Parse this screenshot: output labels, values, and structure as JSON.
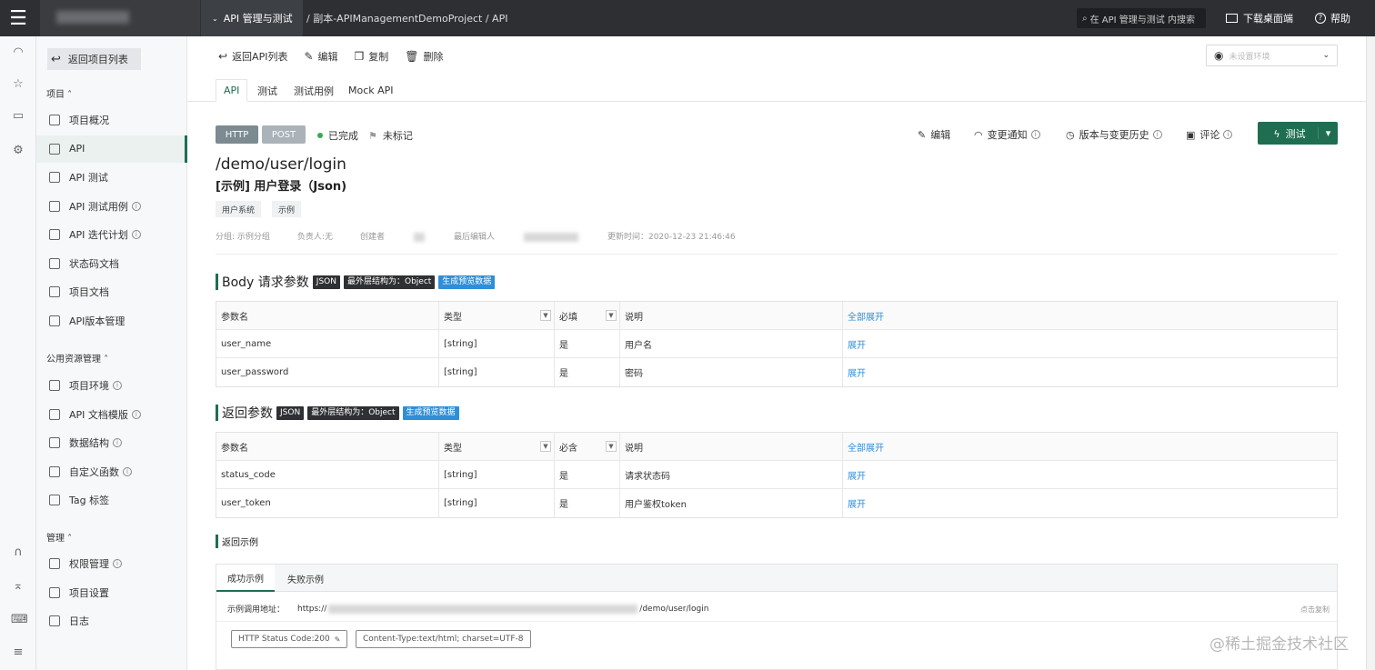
{
  "topbar": {
    "module": "API 管理与测试",
    "breadcrumb": "/ 副本-APIManagementDemoProject / API",
    "search_placeholder": "在 API 管理与测试 内搜索",
    "download": "下载桌面端",
    "help": "帮助"
  },
  "sidebar": {
    "back": "返回项目列表",
    "group_project": "项目 ˄",
    "items_project": [
      {
        "label": "项目概况",
        "icon": "overview-icon"
      },
      {
        "label": "API",
        "icon": "api-icon"
      },
      {
        "label": "API 测试",
        "icon": "test-icon"
      },
      {
        "label": "API 测试用例",
        "icon": "testcase-icon"
      },
      {
        "label": "API 迭代计划",
        "icon": "plan-icon"
      },
      {
        "label": "状态码文档",
        "icon": "code-doc-icon"
      },
      {
        "label": "项目文档",
        "icon": "doc-icon"
      },
      {
        "label": "API版本管理",
        "icon": "version-icon"
      }
    ],
    "group_public": "公用资源管理 ˄",
    "items_public": [
      {
        "label": "项目环境",
        "icon": "env-icon"
      },
      {
        "label": "API 文档模版",
        "icon": "template-icon"
      },
      {
        "label": "数据结构",
        "icon": "struct-icon"
      },
      {
        "label": "自定义函数",
        "icon": "function-icon"
      },
      {
        "label": "Tag 标签",
        "icon": "tag-icon"
      }
    ],
    "group_manage": "管理 ˄",
    "items_manage": [
      {
        "label": "权限管理",
        "icon": "permission-icon"
      },
      {
        "label": "项目设置",
        "icon": "settings-icon"
      },
      {
        "label": "日志",
        "icon": "log-icon"
      }
    ]
  },
  "toolbar": {
    "back": "返回API列表",
    "edit": "编辑",
    "copy": "复制",
    "delete": "删除",
    "env_placeholder": "未设置环境"
  },
  "tabs": [
    "API",
    "测试",
    "测试用例",
    "Mock API"
  ],
  "api": {
    "protocol": "HTTP",
    "method": "POST",
    "status": "已完成",
    "mark": "未标记",
    "path": "/demo/user/login",
    "name": "[示例] 用户登录（Json)",
    "tags": [
      "用户系统",
      "示例"
    ],
    "meta": {
      "group": "分组: 示例分组",
      "owner": "负责人:无",
      "creator": "创建者",
      "editor": "最后编辑人",
      "updated": "更新时间：2020-12-23 21:46:46"
    },
    "actions": {
      "edit": "编辑",
      "notify": "变更通知",
      "history": "版本与变更历史",
      "comment": "评论",
      "test": "测试"
    }
  },
  "body_params": {
    "title": "Body 请求参数",
    "fmt": "JSON",
    "outer": "最外层结构为：Object",
    "gen": "生成预览数据",
    "headers": [
      "参数名",
      "类型",
      "必填",
      "说明",
      "全部展开"
    ],
    "rows": [
      {
        "name": "user_name",
        "type": "[string]",
        "req": "是",
        "desc": "用户名",
        "act": "展开"
      },
      {
        "name": "user_password",
        "type": "[string]",
        "req": "是",
        "desc": "密码",
        "act": "展开"
      }
    ]
  },
  "return_params": {
    "title": "返回参数",
    "fmt": "JSON",
    "outer": "最外层结构为：Object",
    "gen": "生成预览数据",
    "headers": [
      "参数名",
      "类型",
      "必含",
      "说明",
      "全部展开"
    ],
    "rows": [
      {
        "name": "status_code",
        "type": "[string]",
        "req": "是",
        "desc": "请求状态码",
        "act": "展开"
      },
      {
        "name": "user_token",
        "type": "[string]",
        "req": "是",
        "desc": "用户鉴权token",
        "act": "展开"
      }
    ]
  },
  "example": {
    "title": "返回示例",
    "tabs": [
      "成功示例",
      "失败示例"
    ],
    "url_label": "示例调用地址：",
    "url_prefix": "https://",
    "url_suffix": "/demo/user/login",
    "copy": "点击复制",
    "status_code": "HTTP Status Code:200",
    "content_type": "Content-Type:text/html; charset=UTF-8"
  },
  "watermark": "@稀土掘金技术社区",
  "colors": {
    "primary": "#1f6e52",
    "link": "#2f8ed8",
    "topbar": "#2d2f33"
  }
}
